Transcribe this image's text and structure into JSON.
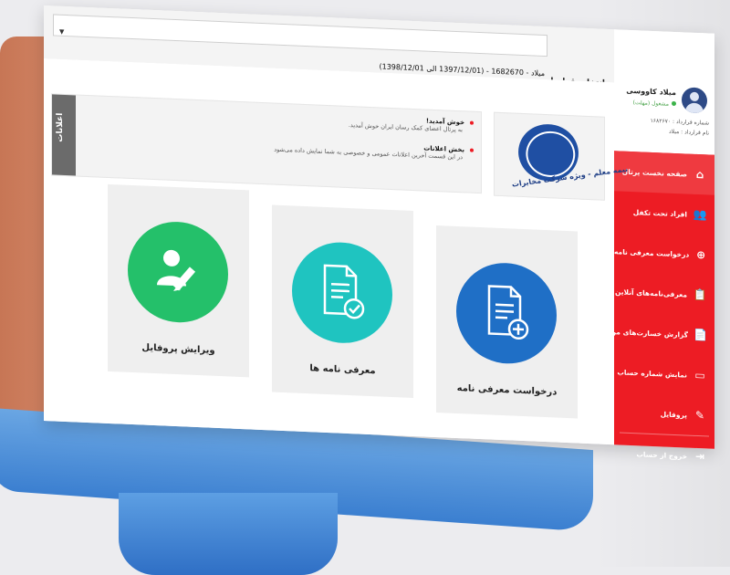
{
  "sidebar": {
    "user": {
      "name": "میلاد کاووسی",
      "status": "مشغول (مهلت)",
      "contract_no": "شماره قرارداد : ۱۶۸۲۶۷۰",
      "contract_name": "نام قرارداد : میلاد"
    },
    "menu": [
      {
        "label": "صفحه نخست پرتال",
        "icon": "home-icon",
        "active": true
      },
      {
        "label": "افراد تحت تکفل",
        "icon": "people-icon",
        "active": false
      },
      {
        "label": "درخواست معرفی نامه",
        "icon": "plus-circle-icon",
        "active": false
      },
      {
        "label": "معرفی‌نامه‌های آنلاین",
        "icon": "clipboard-icon",
        "active": false
      },
      {
        "label": "گزارش خسارت‌های من",
        "icon": "report-icon",
        "active": false
      },
      {
        "label": "نمایش شماره حساب",
        "icon": "card-icon",
        "active": false
      },
      {
        "label": "پروفایل",
        "icon": "user-edit-icon",
        "active": false
      },
      {
        "label": "خروج از حساب",
        "icon": "logout-icon",
        "active": false
      }
    ],
    "colors": {
      "menu_bg": "#ed1c24"
    }
  },
  "topbar": {
    "contract_label": "انتخاب قرارداد",
    "contract_value": "میلاد - 1682670 - (1397/12/01 الی 1398/12/01)"
  },
  "announcements": {
    "tab_label": "اعلانات",
    "items": [
      {
        "title": "خوش آمدید!",
        "body": "به پرتال اعضای کمک رسان ایران خوش آمدید."
      },
      {
        "title": "بخش اعلانات",
        "body": "در این قسمت آخرین اعلانات عمومی و خصوصی به شما نمایش داده می‌شود"
      }
    ]
  },
  "logo": {
    "text": "بیمه معلم - ویژه شرکت مخابرات"
  },
  "cards": [
    {
      "label": "درخواست معرفی نامه",
      "color": "#1f6fc6",
      "icon": "document-plus-icon"
    },
    {
      "label": "معرفی نامه ها",
      "color": "#1fc4c0",
      "icon": "document-check-icon"
    },
    {
      "label": "ویرایش پروفایل",
      "color": "#24c06a",
      "icon": "user-edit-icon"
    }
  ]
}
